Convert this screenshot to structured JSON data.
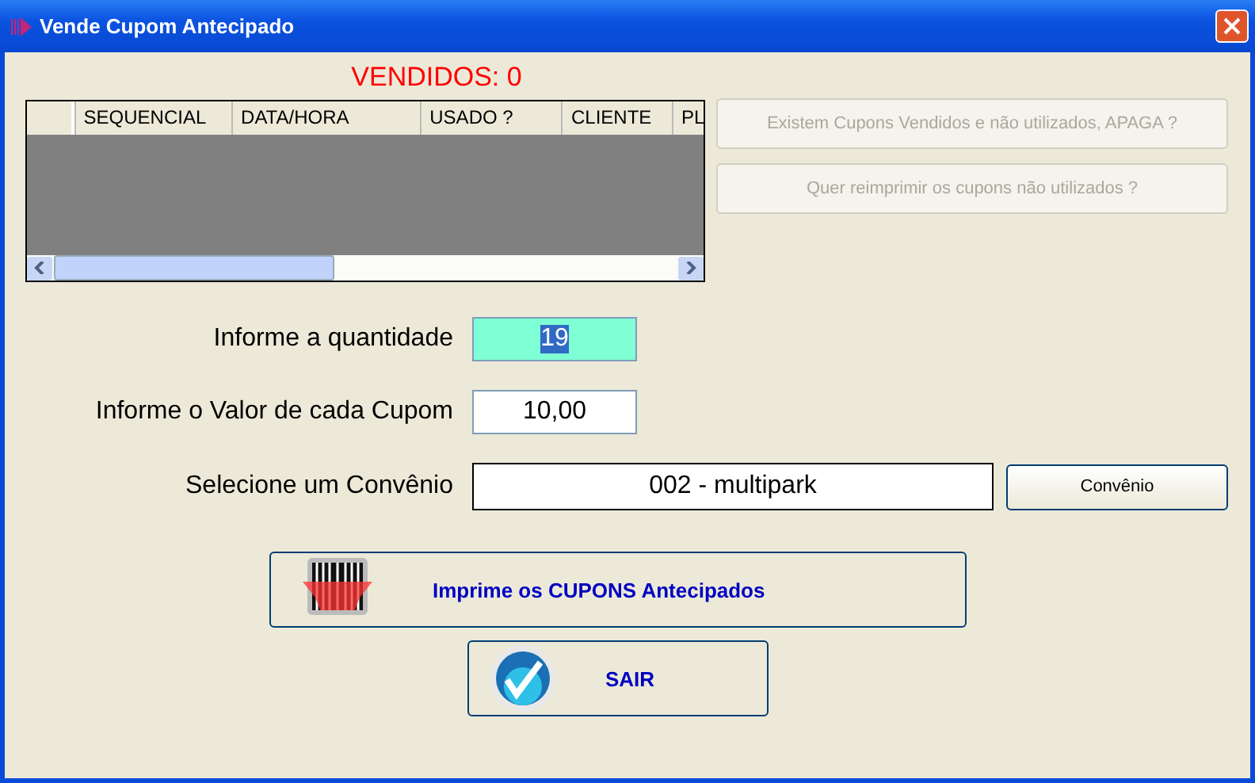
{
  "window": {
    "title": "Vende Cupom Antecipado"
  },
  "sold_counter": "VENDIDOS: 0",
  "table": {
    "columns": [
      "SEQUENCIAL",
      "DATA/HORA",
      "USADO ?",
      "CLIENTE",
      "PL"
    ]
  },
  "side_buttons": [
    {
      "label": "Existem Cupons Vendidos e não utilizados, APAGA ?",
      "disabled": true
    },
    {
      "label": "Quer reimprimir os cupons não utilizados ?",
      "disabled": true
    }
  ],
  "form": [
    {
      "label": "Informe a quantidade",
      "value": "19",
      "focused": true
    },
    {
      "label": "Informe o Valor de cada Cupom",
      "value": "10,00",
      "focused": false
    }
  ],
  "convenio": {
    "label": "Selecione um Convênio",
    "value": "002 - multipark",
    "button": "Convênio"
  },
  "actions": [
    {
      "kind": "barcode",
      "label": "Imprime os CUPONS Antecipados"
    },
    {
      "kind": "check",
      "label": "SAIR"
    }
  ]
}
